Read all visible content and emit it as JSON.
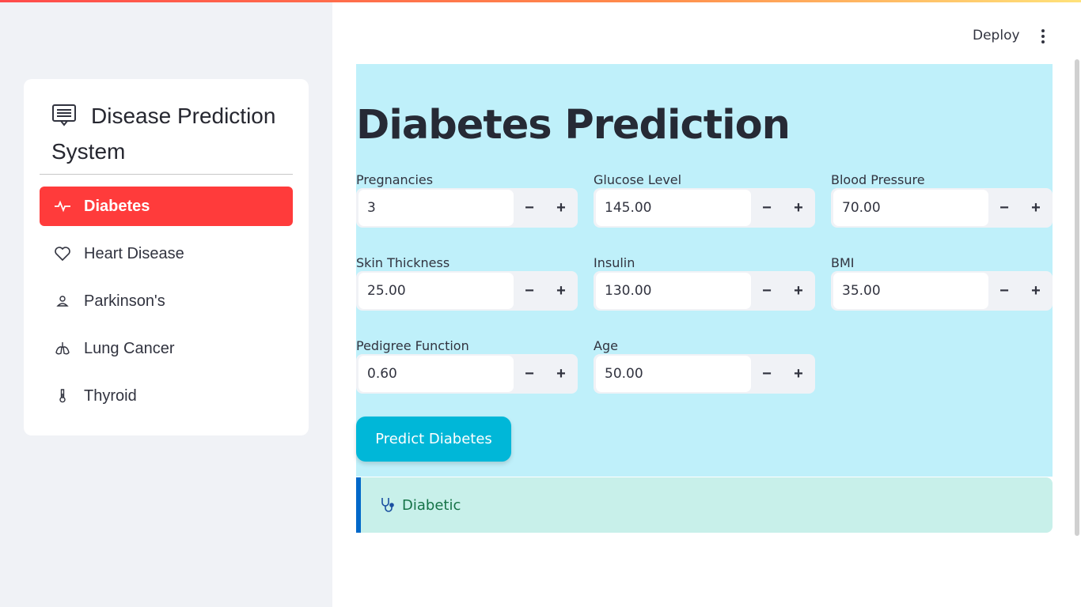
{
  "sidebar": {
    "title": "Disease Prediction System",
    "items": [
      {
        "label": "Diabetes",
        "icon": "activity-icon",
        "active": true
      },
      {
        "label": "Heart Disease",
        "icon": "heart-icon",
        "active": false
      },
      {
        "label": "Parkinson's",
        "icon": "person-icon",
        "active": false
      },
      {
        "label": "Lung Cancer",
        "icon": "lungs-icon",
        "active": false
      },
      {
        "label": "Thyroid",
        "icon": "thermometer-icon",
        "active": false
      }
    ]
  },
  "header": {
    "deploy_label": "Deploy"
  },
  "main": {
    "title": "Diabetes Prediction",
    "fields": [
      {
        "label": "Pregnancies",
        "value": "3"
      },
      {
        "label": "Glucose Level",
        "value": "145.00"
      },
      {
        "label": "Blood Pressure",
        "value": "70.00"
      },
      {
        "label": "Skin Thickness",
        "value": "25.00"
      },
      {
        "label": "Insulin",
        "value": "130.00"
      },
      {
        "label": "BMI",
        "value": "35.00"
      },
      {
        "label": "Pedigree Function",
        "value": "0.60"
      },
      {
        "label": "Age",
        "value": "50.00"
      }
    ],
    "minus_symbol": "−",
    "plus_symbol": "+",
    "predict_label": "Predict Diabetes",
    "result_text": "Diabetic"
  },
  "colors": {
    "accent": "#ff3b3b",
    "panel_bg": "#bff0fa",
    "button": "#00b7d8",
    "result_bg": "#c8f0ea",
    "result_text": "#157347"
  }
}
